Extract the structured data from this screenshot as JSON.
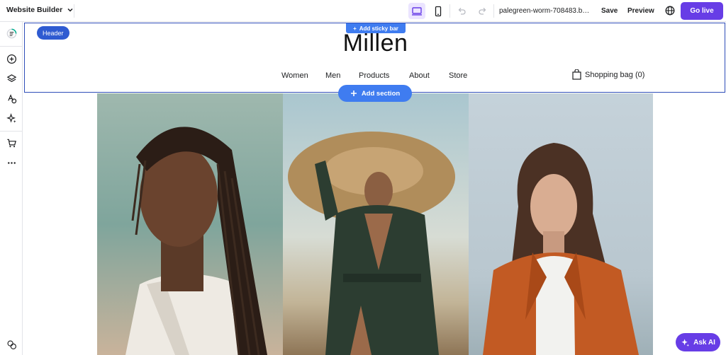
{
  "topbar": {
    "app_name": "Website Builder",
    "site_url": "palegreen-worm-708483.buil...",
    "save_label": "Save",
    "preview_label": "Preview",
    "go_live_label": "Go live"
  },
  "canvas": {
    "header_tag": "Header",
    "sticky_bar_label": "Add sticky bar",
    "add_section_label": "Add section",
    "site_logo": "Millen",
    "nav": [
      "Women",
      "Men",
      "Products",
      "About",
      "Store"
    ],
    "cart_label": "Shopping bag (0)"
  },
  "assistant": {
    "label": "Ask AI"
  },
  "colors": {
    "brand_purple": "#673de6",
    "editor_blue": "#3f7cf0",
    "header_outline": "#2f4db8"
  }
}
